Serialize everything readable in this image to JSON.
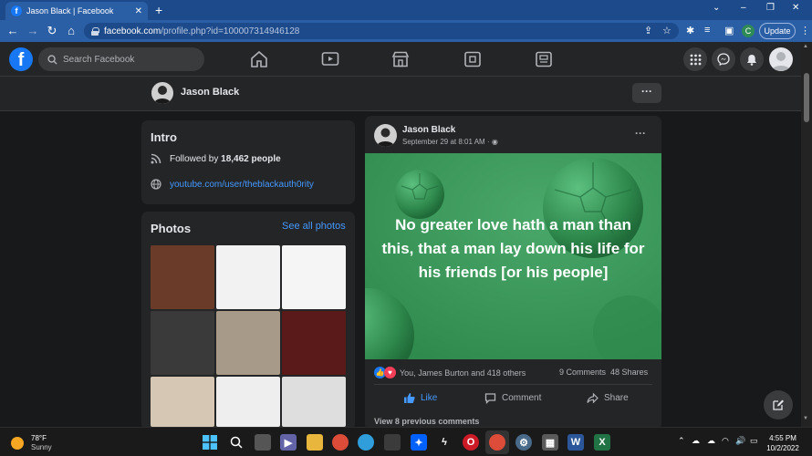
{
  "browser": {
    "tab_title": "Jason Black | Facebook",
    "tab_favicon": "f",
    "url_host": "facebook.com",
    "url_path": "/profile.php?id=100007314946128",
    "profile_initial": "C",
    "update_label": "Update"
  },
  "fb_nav": {
    "logo": "f",
    "search_placeholder": "Search Facebook"
  },
  "profile_header": {
    "name": "Jason Black",
    "more_label": "···"
  },
  "intro": {
    "title": "Intro",
    "followed_prefix": "Followed by ",
    "followed_count": "18,462 people",
    "link": "youtube.com/user/theblackauth0rity"
  },
  "photos": {
    "title": "Photos",
    "see_all": "See all photos",
    "tiles": [
      {
        "name": "photo-1",
        "color": "#6b3b2a"
      },
      {
        "name": "photo-2",
        "color": "#f2f2f2"
      },
      {
        "name": "photo-3",
        "color": "#f5f5f5"
      },
      {
        "name": "photo-4",
        "color": "#3a3a3a"
      },
      {
        "name": "photo-5",
        "color": "#a89a88"
      },
      {
        "name": "photo-6",
        "color": "#5a1a1a"
      },
      {
        "name": "photo-7",
        "color": "#d6c6b4"
      },
      {
        "name": "photo-8",
        "color": "#eeeeee"
      },
      {
        "name": "photo-9",
        "color": "#dedede"
      }
    ]
  },
  "post": {
    "author": "Jason Black",
    "time": "September 29 at 8:01 AM · ",
    "quote": "No greater love hath a man than this, that a man lay down his life for his friends [or his people]",
    "reactions_text": "You, James Burton and 418 others",
    "comments": "9 Comments",
    "shares": "48 Shares",
    "like_label": "Like",
    "comment_label": "Comment",
    "share_label": "Share",
    "view_previous": "View 8 previous comments",
    "colors": {
      "like": "#4599ff",
      "action": "#b0b3b8",
      "image_bg": "#3e9a5c"
    }
  },
  "taskbar": {
    "temperature": "78°F",
    "condition": "Sunny",
    "time": "4:55 PM",
    "date": "10/2/2022"
  }
}
